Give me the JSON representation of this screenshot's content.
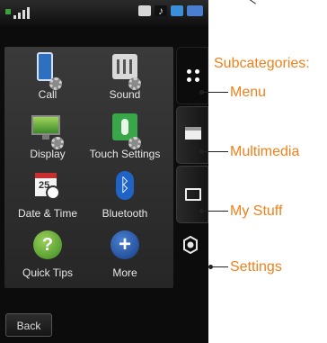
{
  "apps": [
    {
      "label": "Call",
      "icon": "phone-settings-icon"
    },
    {
      "label": "Sound",
      "icon": "sound-settings-icon"
    },
    {
      "label": "Display",
      "icon": "display-settings-icon"
    },
    {
      "label": "Touch Settings",
      "icon": "touch-settings-icon"
    },
    {
      "label": "Date & Time",
      "icon": "calendar-clock-icon"
    },
    {
      "label": "Bluetooth",
      "icon": "bluetooth-icon"
    },
    {
      "label": "Quick Tips",
      "icon": "question-icon"
    },
    {
      "label": "More",
      "icon": "plus-icon"
    }
  ],
  "back_label": "Back",
  "callouts": {
    "title": "Subcategories:",
    "menu": "Menu",
    "multimedia": "Multimedia",
    "my_stuff": "My Stuff",
    "settings": "Settings"
  },
  "colors": {
    "callout": "#f0801a",
    "background": "#0c0c0c"
  }
}
